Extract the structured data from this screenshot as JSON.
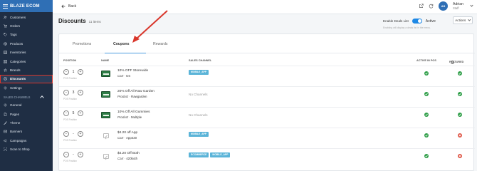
{
  "sidebar": {
    "brand": "BLAZE ECOM",
    "items": [
      {
        "label": "Customers",
        "icon": "users-icon"
      },
      {
        "label": "Orders",
        "icon": "cart-icon"
      },
      {
        "label": "Tags",
        "icon": "tag-icon"
      },
      {
        "label": "Products",
        "icon": "box-icon"
      },
      {
        "label": "Inventories",
        "icon": "inventory-icon"
      },
      {
        "label": "Categories",
        "icon": "categories-icon"
      },
      {
        "label": "Brands",
        "icon": "brand-icon"
      },
      {
        "label": "Discounts",
        "icon": "discount-icon",
        "active": true
      },
      {
        "label": "Settings",
        "icon": "gear-icon"
      }
    ],
    "section_label": "SALES CHANNELS",
    "channel_items": [
      {
        "label": "General",
        "icon": "gear-icon"
      },
      {
        "label": "Pages",
        "icon": "page-icon"
      },
      {
        "label": "Theme",
        "icon": "theme-icon"
      },
      {
        "label": "Banners",
        "icon": "banner-icon"
      },
      {
        "label": "Campaigns",
        "icon": "campaign-icon"
      },
      {
        "label": "Scan to Shop",
        "icon": "scan-icon"
      }
    ]
  },
  "header": {
    "back_label": "Back",
    "user_initials": "AS",
    "user_name": "Adrian",
    "user_role": "Staff"
  },
  "page": {
    "title": "Discounts",
    "count": "11 items",
    "deals_label": "Enable Deals List",
    "deals_state": "Active",
    "deals_hint": "Enabling will display a deals list in the menu.",
    "actions_label": "Actions"
  },
  "tabs": [
    "Promotions",
    "Coupons",
    "Rewards"
  ],
  "table": {
    "headers": {
      "position": "POSITION",
      "name": "NAME",
      "sales_channel": "SALES CHANNEL",
      "active_in_pos": "ACTIVE IN POS",
      "featured": "FEATURED"
    },
    "position_label": "POS Position",
    "rows": [
      {
        "position": "1",
        "name": "10% OFF Storewide",
        "target_type": "Cart",
        "target": "ten",
        "channels": [
          "MOBILE_APP"
        ],
        "no_channels": "",
        "has_image": true,
        "active": true,
        "featured": true
      },
      {
        "position": "3",
        "name": "20% Off All Raw Garden",
        "target_type": "Product",
        "target": "Rawgarden",
        "channels": [],
        "no_channels": "No Channels",
        "has_image": true,
        "active": true,
        "featured": true
      },
      {
        "position": "5",
        "name": "10% Off All Gummies",
        "target_type": "Product",
        "target": "Multiple",
        "channels": [],
        "no_channels": "No Channels",
        "has_image": true,
        "active": true,
        "featured": true
      },
      {
        "position": "-",
        "name": "$4.20 off App",
        "target_type": "Cart",
        "target": "App420",
        "channels": [
          "MOBILE_APP"
        ],
        "no_channels": "",
        "has_image": false,
        "active": true,
        "featured": false
      },
      {
        "position": "-",
        "name": "$4.20 Off Both",
        "target_type": "Cart",
        "target": "420both",
        "channels": [
          "ECOMMERCE",
          "MOBILE_APP"
        ],
        "no_channels": "",
        "has_image": false,
        "active": true,
        "featured": false
      }
    ]
  },
  "colors": {
    "sidebar_bg": "#1f2e44",
    "brand_bg": "#2f6fb5",
    "accent": "#1e88e5",
    "chip": "#5bb4d8",
    "active_green": "#2e9e47",
    "inactive_red": "#e05848",
    "annotation_red": "#d9362b"
  }
}
